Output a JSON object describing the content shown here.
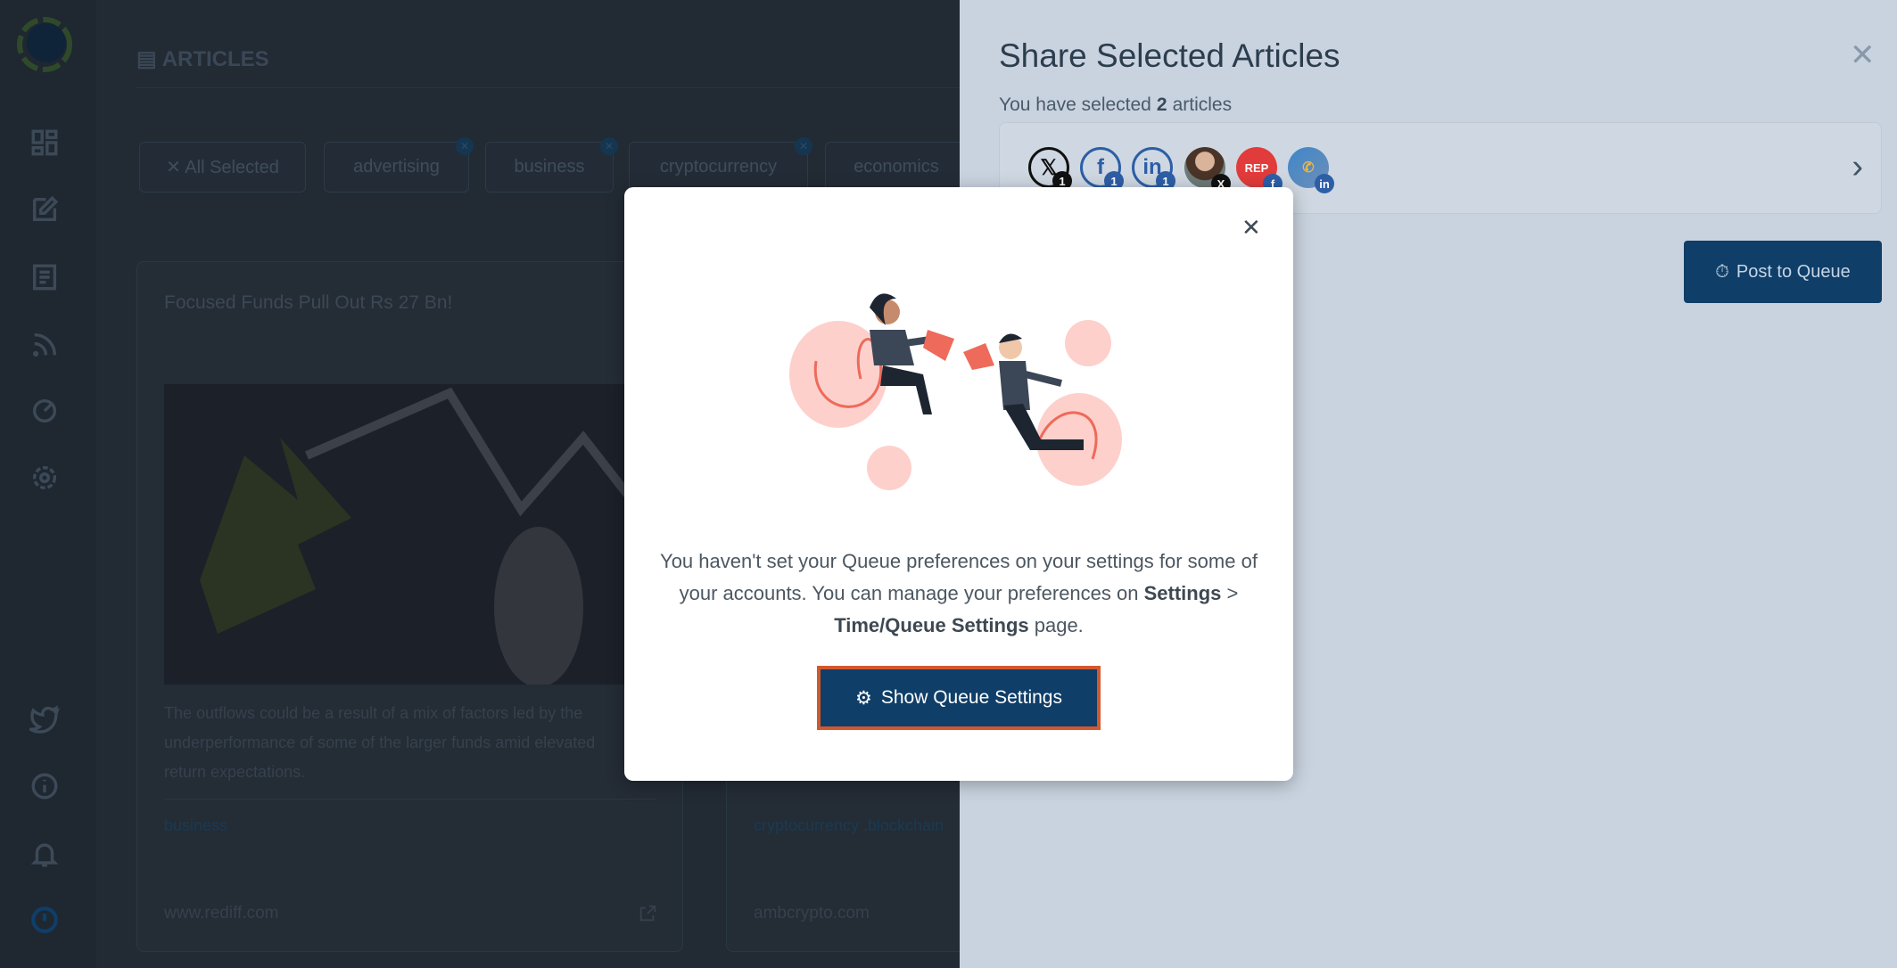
{
  "sidebar": {
    "items": [
      "dashboard-icon",
      "compose-icon",
      "articles-icon",
      "rss-icon",
      "analytics-icon",
      "gear-icon"
    ],
    "bottom": [
      "twitter-icon",
      "info-icon",
      "bell-icon",
      "power-icon"
    ]
  },
  "main": {
    "heading": "ARTICLES",
    "chips": [
      {
        "label": "✕ All Selected"
      },
      {
        "label": "advertising"
      },
      {
        "label": "business"
      },
      {
        "label": "cryptocurrency"
      },
      {
        "label": "economics"
      }
    ],
    "cards": [
      {
        "title": "Focused Funds Pull Out Rs 27 Bn!",
        "description": "The outflows could be a result of a mix of factors led by the underperformance of some of the larger funds amid elevated return expectations.",
        "tags": "business",
        "domain": "www.rediff.com"
      },
      {
        "title": "",
        "description": "",
        "tags": "cryptocurrency ,blockchain",
        "domain": "ambcrypto.com"
      }
    ]
  },
  "panel": {
    "title": "Share Selected Articles",
    "subtitle_pre": "You have selected",
    "count": "2",
    "subtitle_post": "articles",
    "accounts": [
      {
        "icon": "x-icon",
        "badge": "1",
        "badge_color": "#111111"
      },
      {
        "icon": "facebook-icon",
        "badge": "1",
        "badge_color": "#2d5ea6"
      },
      {
        "icon": "linkedin-icon",
        "badge": "1",
        "badge_color": "#2d5ea6"
      },
      {
        "icon": "profile-photo",
        "badge": "X",
        "badge_color": "#111111"
      },
      {
        "icon": "red-logo",
        "label": "REP",
        "badge": "f",
        "badge_color": "#2d5ea6"
      },
      {
        "icon": "blue-logo",
        "badge": "in",
        "badge_color": "#2d5ea6"
      }
    ],
    "post_to_queue": "Post to Queue"
  },
  "modal": {
    "line1": "You haven't set your Queue preferences on your settings for some of your accounts. You can manage your preferences on",
    "bold1": "Settings",
    "sep": " > ",
    "bold2": "Time/Queue Settings",
    "line_end": " page.",
    "button": "Show Queue Settings"
  },
  "colors": {
    "primary": "#0f3e68",
    "focus_outline": "#d2582e",
    "panel_bg": "#c9d3df"
  }
}
